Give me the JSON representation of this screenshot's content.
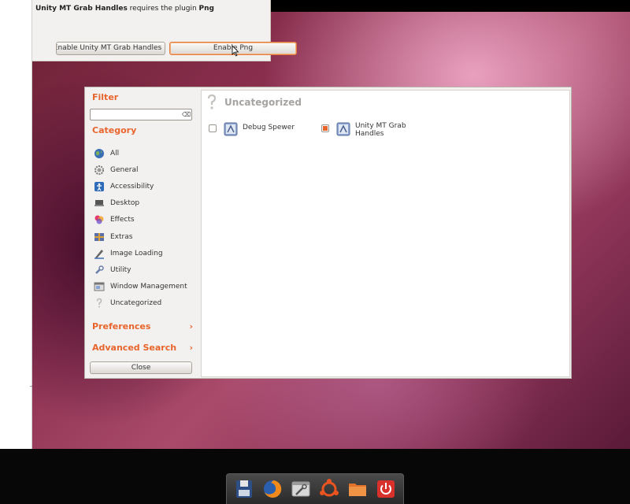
{
  "background_dialog": {
    "message_bold": "Unity MT Grab Handles",
    "message_rest": " requires the plugin ",
    "message_plugin": "Png",
    "enable_unity_label": "Enable Unity MT Grab Handles",
    "enable_png_label": "Enable Png"
  },
  "sidebar": {
    "filter_title": "Filter",
    "filter_value": "",
    "category_title": "Category",
    "categories": [
      {
        "label": "All",
        "icon": "globe-icon"
      },
      {
        "label": "General",
        "icon": "gear-icon"
      },
      {
        "label": "Accessibility",
        "icon": "accessibility-icon"
      },
      {
        "label": "Desktop",
        "icon": "desktop-icon"
      },
      {
        "label": "Effects",
        "icon": "effects-icon"
      },
      {
        "label": "Extras",
        "icon": "extras-icon"
      },
      {
        "label": "Image Loading",
        "icon": "image-loading-icon"
      },
      {
        "label": "Utility",
        "icon": "utility-icon"
      },
      {
        "label": "Window Management",
        "icon": "window-management-icon"
      },
      {
        "label": "Uncategorized",
        "icon": "question-icon"
      }
    ],
    "preferences_label": "Preferences",
    "advanced_search_label": "Advanced Search",
    "close_label": "Close"
  },
  "content": {
    "title": "Uncategorized",
    "plugins": [
      {
        "name": "Debug Spewer",
        "enabled": false
      },
      {
        "name": "Unity MT Grab Handles",
        "enabled": true
      }
    ]
  },
  "dock": {
    "apps": [
      "save-icon",
      "firefox-icon",
      "settings-icon",
      "ubuntu-icon",
      "folder-icon",
      "power-icon"
    ]
  },
  "colors": {
    "accent": "#e8652d"
  }
}
